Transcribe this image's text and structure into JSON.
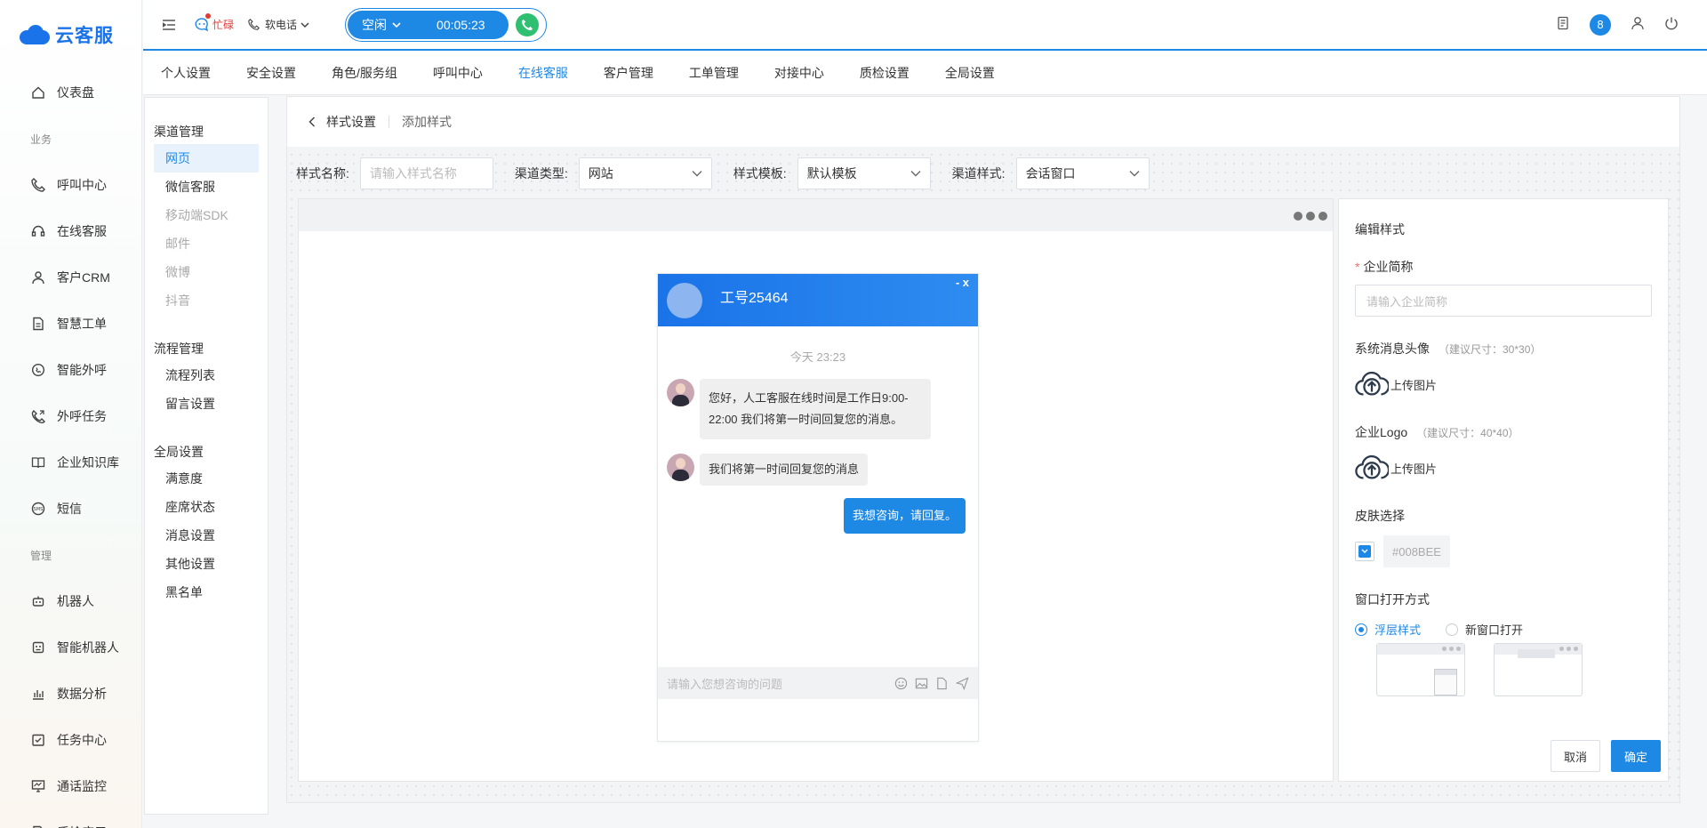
{
  "app": {
    "name": "云客服"
  },
  "sidebar": {
    "items": [
      {
        "label": "仪表盘",
        "icon": "home-icon"
      },
      {
        "group": "业务"
      },
      {
        "label": "呼叫中心",
        "icon": "phone-icon"
      },
      {
        "label": "在线客服",
        "icon": "headset-icon"
      },
      {
        "label": "客户CRM",
        "icon": "user-icon"
      },
      {
        "label": "智慧工单",
        "icon": "document-icon"
      },
      {
        "label": "智能外呼",
        "icon": "whatsapp-icon"
      },
      {
        "label": "外呼任务",
        "icon": "phone-out-icon"
      },
      {
        "label": "企业知识库",
        "icon": "book-icon"
      },
      {
        "label": "短信",
        "icon": "sms-icon"
      },
      {
        "group": "管理"
      },
      {
        "label": "机器人",
        "icon": "robot-icon"
      },
      {
        "label": "智能机器人",
        "icon": "smart-robot-icon"
      },
      {
        "label": "数据分析",
        "icon": "bar-chart-icon"
      },
      {
        "label": "任务中心",
        "icon": "task-icon"
      },
      {
        "label": "通话监控",
        "icon": "monitor-icon"
      },
      {
        "label": "质检应用",
        "icon": "inspection-icon"
      }
    ]
  },
  "header": {
    "status": "忙碌",
    "phone_mode": "软电话",
    "call_state": "空闲",
    "call_timer": "00:05:23",
    "notifications": "8"
  },
  "tabs": [
    {
      "label": "个人设置"
    },
    {
      "label": "安全设置"
    },
    {
      "label": "角色/服务组"
    },
    {
      "label": "呼叫中心"
    },
    {
      "label": "在线客服",
      "active": true
    },
    {
      "label": "客户管理"
    },
    {
      "label": "工单管理"
    },
    {
      "label": "对接中心"
    },
    {
      "label": "质检设置"
    },
    {
      "label": "全局设置"
    }
  ],
  "subnav": {
    "groups": [
      {
        "title": "渠道管理",
        "items": [
          {
            "label": "网页",
            "state": "active"
          },
          {
            "label": "微信客服",
            "state": "normal"
          },
          {
            "label": "移动端SDK",
            "state": "disabled"
          },
          {
            "label": "邮件",
            "state": "disabled"
          },
          {
            "label": "微博",
            "state": "disabled"
          },
          {
            "label": "抖音",
            "state": "disabled"
          }
        ]
      },
      {
        "title": "流程管理",
        "items": [
          {
            "label": "流程列表",
            "state": "normal"
          },
          {
            "label": "留言设置",
            "state": "normal"
          }
        ]
      },
      {
        "title": "全局设置",
        "items": [
          {
            "label": "满意度",
            "state": "normal"
          },
          {
            "label": "座席状态",
            "state": "normal"
          },
          {
            "label": "消息设置",
            "state": "normal"
          },
          {
            "label": "其他设置",
            "state": "normal"
          },
          {
            "label": "黑名单",
            "state": "normal"
          }
        ]
      }
    ]
  },
  "breadcrumb": {
    "parent": "样式设置",
    "current": "添加样式"
  },
  "filters": {
    "style_name_label": "样式名称:",
    "style_name_placeholder": "请输入样式名称",
    "channel_type_label": "渠道类型:",
    "channel_type_value": "网站",
    "template_label": "样式模板:",
    "template_value": "默认模板",
    "channel_style_label": "渠道样式:",
    "channel_style_value": "会话窗口"
  },
  "chat": {
    "title": "工号25464",
    "controls": "-  x",
    "time": "今天 23:23",
    "msg1": "您好，人工客服在线时间是工作日9:00-22:00 我们将第一时间回复您的消息。",
    "msg2": "我们将第一时间回复您的消息",
    "mine": "我想咨询，请回复。",
    "input_placeholder": "请输入您想咨询的问题"
  },
  "edit": {
    "title": "编辑样式",
    "company_label": "企业简称",
    "company_placeholder": "请输入企业简称",
    "avatar_label": "系统消息头像",
    "avatar_hint": "（建议尺寸：30*30）",
    "upload_label": "上传图片",
    "logo_label": "企业Logo",
    "logo_hint": "（建议尺寸：40*40）",
    "skin_label": "皮肤选择",
    "skin_color": "#008BEE",
    "open_label": "窗口打开方式",
    "open_float": "浮层样式",
    "open_new": "新窗口打开",
    "cancel": "取消",
    "confirm": "确定"
  },
  "colors": {
    "primary": "#1E88E5",
    "call_green": "#2FBF71",
    "busy_red": "#E53935"
  }
}
